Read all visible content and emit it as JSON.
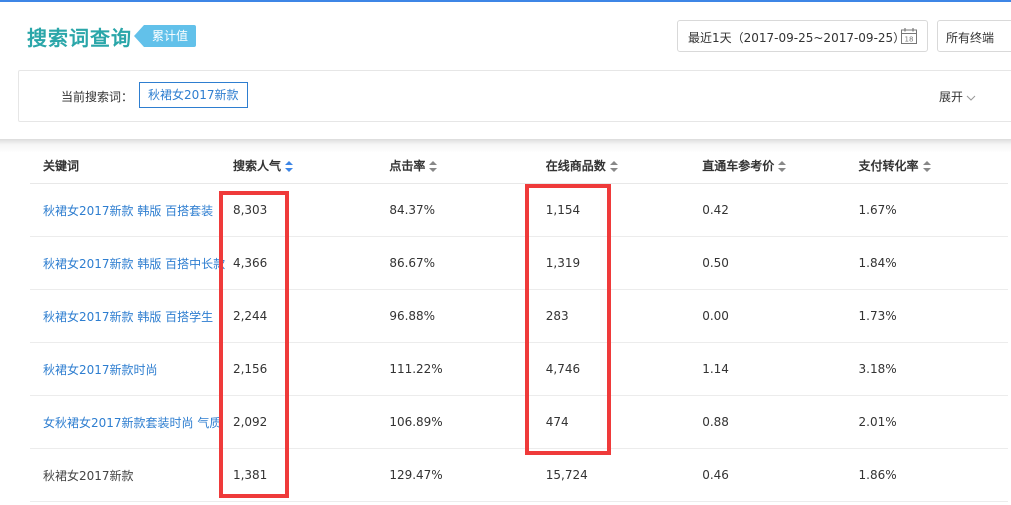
{
  "header": {
    "title": "搜索词查询",
    "tag": "累计值",
    "date_range": "最近1天（2017-09-25~2017-09-25）",
    "calendar_day": "18",
    "terminal": "所有终端"
  },
  "filter": {
    "label": "当前搜索词：",
    "current_term": "秋裙女2017新款",
    "expand_label": "展开"
  },
  "table": {
    "headers": [
      "关键词",
      "搜索人气",
      "点击率",
      "在线商品数",
      "直通车参考价",
      "支付转化率"
    ],
    "rows": [
      {
        "keyword": "秋裙女2017新款 韩版 百搭套装",
        "popularity": "8,303",
        "ctr": "84.37%",
        "online_items": "1,154",
        "ref_price": "0.42",
        "conversion": "1.67%"
      },
      {
        "keyword": "秋裙女2017新款 韩版 百搭中长款",
        "popularity": "4,366",
        "ctr": "86.67%",
        "online_items": "1,319",
        "ref_price": "0.50",
        "conversion": "1.84%"
      },
      {
        "keyword": "秋裙女2017新款 韩版 百搭学生",
        "popularity": "2,244",
        "ctr": "96.88%",
        "online_items": "283",
        "ref_price": "0.00",
        "conversion": "1.73%"
      },
      {
        "keyword": "秋裙女2017新款时尚",
        "popularity": "2,156",
        "ctr": "111.22%",
        "online_items": "4,746",
        "ref_price": "1.14",
        "conversion": "3.18%"
      },
      {
        "keyword": "女秋裙女2017新款套装时尚 气质",
        "popularity": "2,092",
        "ctr": "106.89%",
        "online_items": "474",
        "ref_price": "0.88",
        "conversion": "2.01%"
      },
      {
        "keyword": "秋裙女2017新款",
        "popularity": "1,381",
        "ctr": "129.47%",
        "online_items": "15,724",
        "ref_price": "0.46",
        "conversion": "1.86%"
      }
    ]
  },
  "colors": {
    "title": "#2aa6a9",
    "tag": "#62c1ea",
    "link": "#2e7ed0",
    "highlight": "#ef3a3a",
    "top_accent": "#3d86e6"
  }
}
